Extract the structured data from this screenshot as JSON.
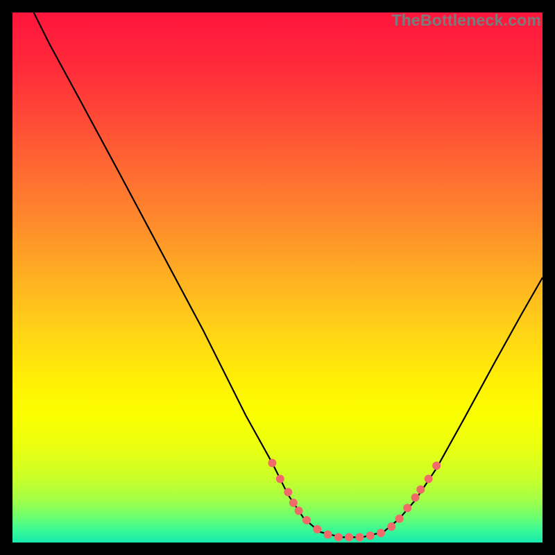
{
  "watermark": "TheBottleneck.com",
  "colors": {
    "black": "#000000",
    "curve": "#000000",
    "dot": "#f06a6a",
    "gradient_stops": [
      {
        "offset": 0.0,
        "color": "#ff153d"
      },
      {
        "offset": 0.1,
        "color": "#ff2a3a"
      },
      {
        "offset": 0.2,
        "color": "#ff4a36"
      },
      {
        "offset": 0.3,
        "color": "#ff6b31"
      },
      {
        "offset": 0.4,
        "color": "#ff8c2b"
      },
      {
        "offset": 0.5,
        "color": "#ffb022"
      },
      {
        "offset": 0.6,
        "color": "#ffd316"
      },
      {
        "offset": 0.7,
        "color": "#fff104"
      },
      {
        "offset": 0.76,
        "color": "#fbff00"
      },
      {
        "offset": 0.82,
        "color": "#eaff0f"
      },
      {
        "offset": 0.88,
        "color": "#c9ff2a"
      },
      {
        "offset": 0.92,
        "color": "#a2ff48"
      },
      {
        "offset": 0.95,
        "color": "#6fff6d"
      },
      {
        "offset": 0.98,
        "color": "#33f79a"
      },
      {
        "offset": 1.0,
        "color": "#19e9ad"
      }
    ]
  },
  "chart_data": {
    "type": "line",
    "title": "",
    "xlabel": "",
    "ylabel": "",
    "xlim": [
      0,
      100
    ],
    "ylim": [
      0,
      100
    ],
    "curve": [
      {
        "x": 4.0,
        "y": 100.0
      },
      {
        "x": 7.0,
        "y": 94.0
      },
      {
        "x": 13.0,
        "y": 83.0
      },
      {
        "x": 20.0,
        "y": 70.0
      },
      {
        "x": 28.0,
        "y": 55.0
      },
      {
        "x": 36.0,
        "y": 40.0
      },
      {
        "x": 44.0,
        "y": 24.0
      },
      {
        "x": 49.0,
        "y": 15.0
      },
      {
        "x": 52.0,
        "y": 9.0
      },
      {
        "x": 55.0,
        "y": 4.5
      },
      {
        "x": 58.0,
        "y": 2.0
      },
      {
        "x": 62.0,
        "y": 1.0
      },
      {
        "x": 66.0,
        "y": 1.0
      },
      {
        "x": 70.0,
        "y": 2.0
      },
      {
        "x": 73.0,
        "y": 4.5
      },
      {
        "x": 76.0,
        "y": 8.0
      },
      {
        "x": 80.0,
        "y": 14.0
      },
      {
        "x": 85.0,
        "y": 23.0
      },
      {
        "x": 91.0,
        "y": 34.0
      },
      {
        "x": 96.0,
        "y": 43.0
      },
      {
        "x": 100.0,
        "y": 50.0
      }
    ],
    "dots": [
      {
        "x": 49.0,
        "y": 15.0
      },
      {
        "x": 50.5,
        "y": 12.0
      },
      {
        "x": 52.0,
        "y": 9.5
      },
      {
        "x": 53.0,
        "y": 7.5
      },
      {
        "x": 54.0,
        "y": 6.0
      },
      {
        "x": 55.5,
        "y": 4.2
      },
      {
        "x": 57.5,
        "y": 2.5
      },
      {
        "x": 59.5,
        "y": 1.5
      },
      {
        "x": 61.5,
        "y": 1.0
      },
      {
        "x": 63.5,
        "y": 1.0
      },
      {
        "x": 65.5,
        "y": 1.0
      },
      {
        "x": 67.5,
        "y": 1.3
      },
      {
        "x": 69.5,
        "y": 1.8
      },
      {
        "x": 71.5,
        "y": 3.0
      },
      {
        "x": 73.0,
        "y": 4.5
      },
      {
        "x": 74.5,
        "y": 6.5
      },
      {
        "x": 76.0,
        "y": 8.5
      },
      {
        "x": 77.0,
        "y": 10.0
      },
      {
        "x": 78.5,
        "y": 12.0
      },
      {
        "x": 80.0,
        "y": 14.5
      }
    ],
    "dot_radius_px": 6
  }
}
